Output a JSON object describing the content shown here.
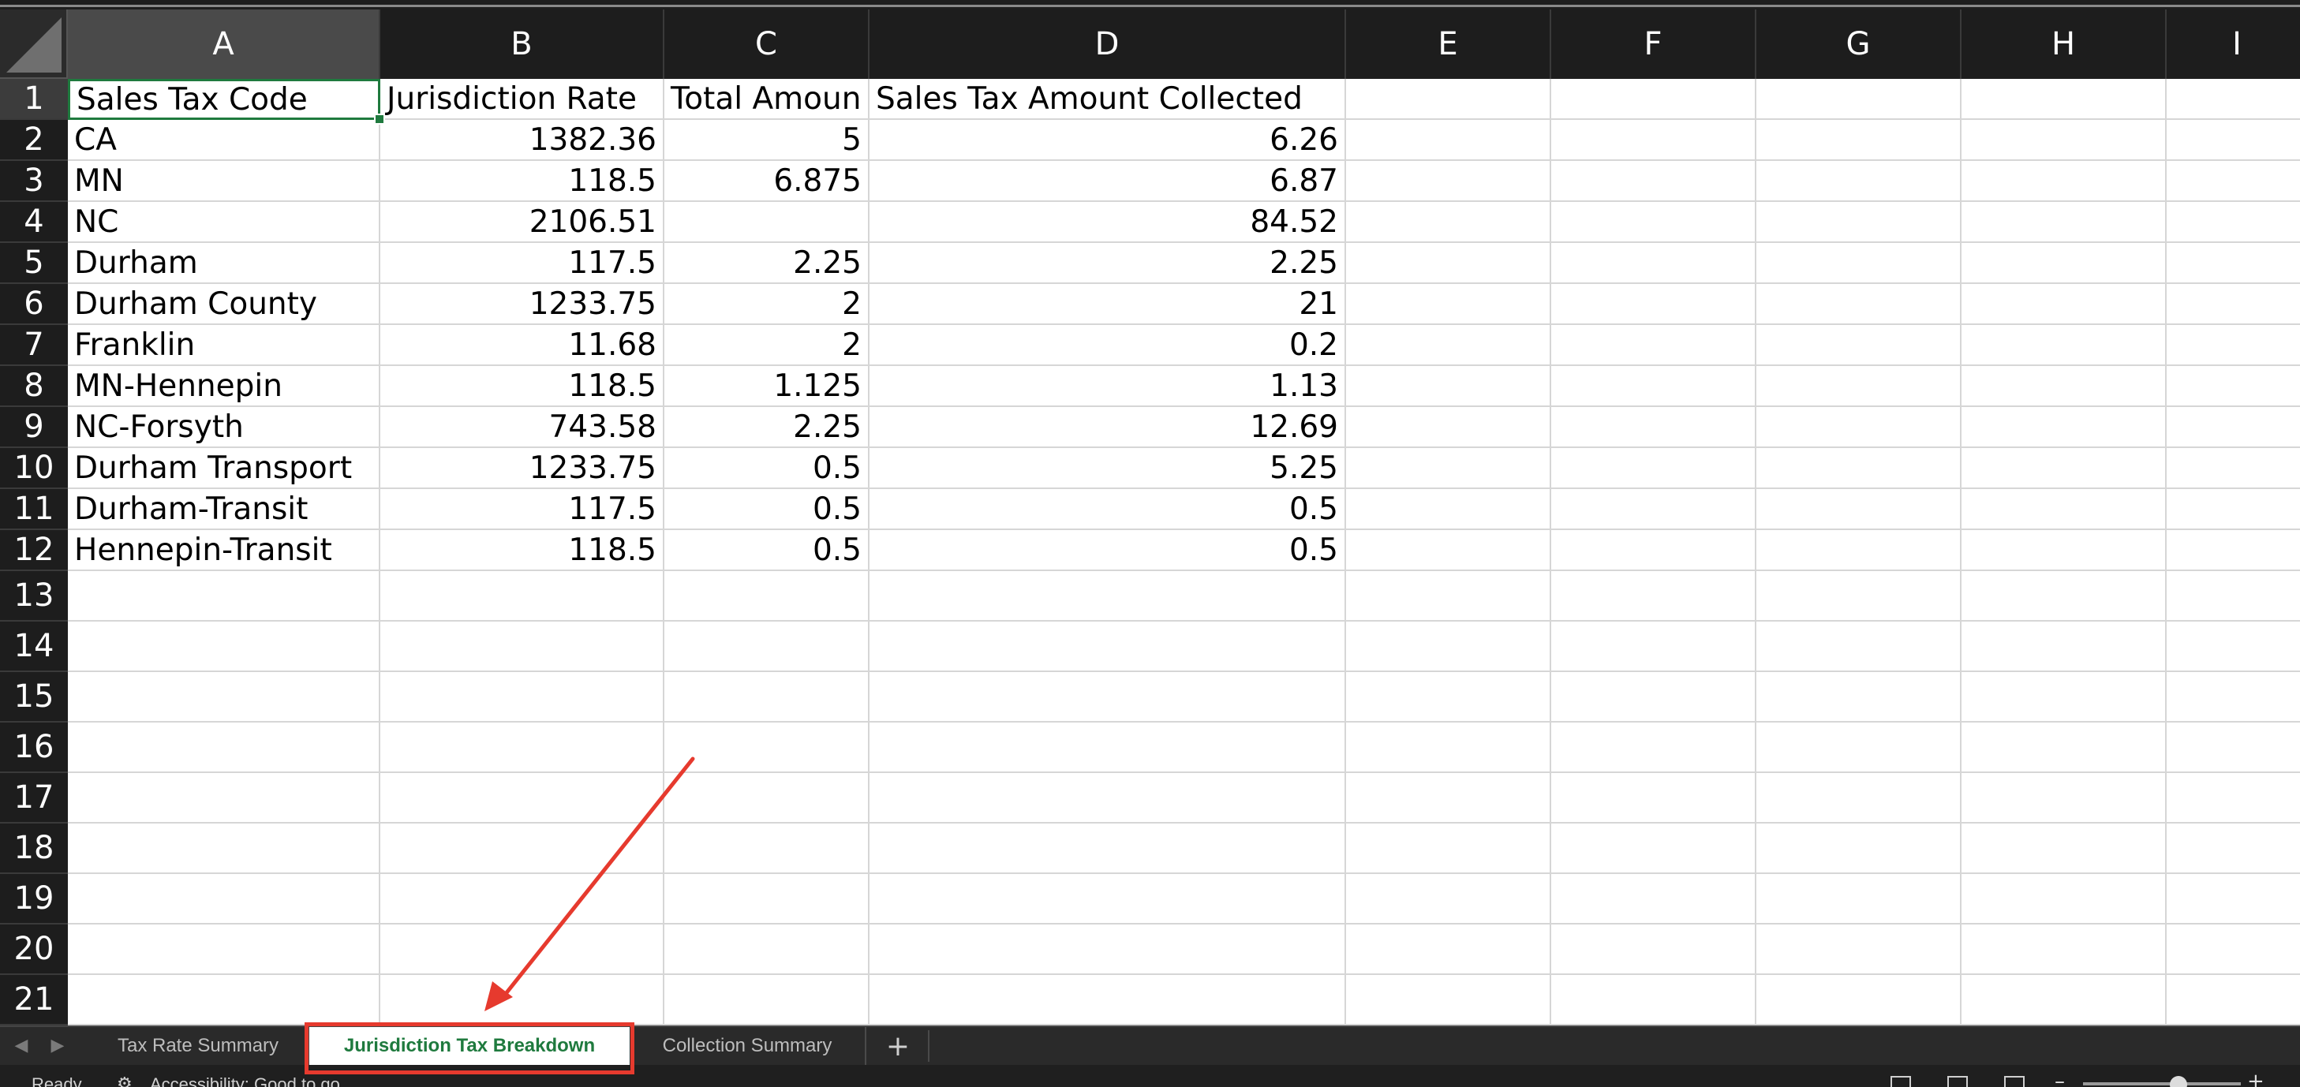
{
  "columns": [
    "A",
    "B",
    "C",
    "D",
    "E",
    "F",
    "G",
    "H",
    "I"
  ],
  "rows": [
    "1",
    "2",
    "3",
    "4",
    "5",
    "6",
    "7",
    "8",
    "9",
    "10",
    "11",
    "12",
    "13",
    "14",
    "15",
    "16",
    "17",
    "18",
    "19",
    "20",
    "21"
  ],
  "cells": [
    [
      "Sales Tax Code",
      "Jurisdiction Rate",
      "Total Amoun",
      "Sales Tax Amount Collected"
    ],
    [
      "CA",
      "1382.36",
      "5",
      "6.26"
    ],
    [
      "MN",
      "118.5",
      "6.875",
      "6.87"
    ],
    [
      "NC",
      "2106.51",
      "",
      "84.52"
    ],
    [
      "Durham",
      "117.5",
      "2.25",
      "2.25"
    ],
    [
      "Durham County",
      "1233.75",
      "2",
      "21"
    ],
    [
      "Franklin",
      "11.68",
      "2",
      "0.2"
    ],
    [
      "MN-Hennepin",
      "118.5",
      "1.125",
      "1.13"
    ],
    [
      "NC-Forsyth",
      "743.58",
      "2.25",
      "12.69"
    ],
    [
      "Durham Transport",
      "1233.75",
      "0.5",
      "5.25"
    ],
    [
      "Durham-Transit",
      "117.5",
      "0.5",
      "0.5"
    ],
    [
      "Hennepin-Transit",
      "118.5",
      "0.5",
      "0.5"
    ]
  ],
  "sheet_tabs": [
    {
      "label": "Tax Rate Summary",
      "active": false
    },
    {
      "label": "Jurisdiction Tax Breakdown",
      "active": true
    },
    {
      "label": "Collection Summary",
      "active": false
    }
  ],
  "add_sheet_label": "+",
  "status": {
    "ready": "Ready",
    "accessibility": "Accessibility: Good to go"
  },
  "icons": {
    "nav_prev": "chevron-left-icon",
    "nav_next": "chevron-right-icon",
    "accessibility": "accessibility-icon"
  },
  "colors": {
    "accent": "#1f7a3e",
    "annotation": "#e63a2e",
    "header_bg": "#1d1d1d"
  }
}
